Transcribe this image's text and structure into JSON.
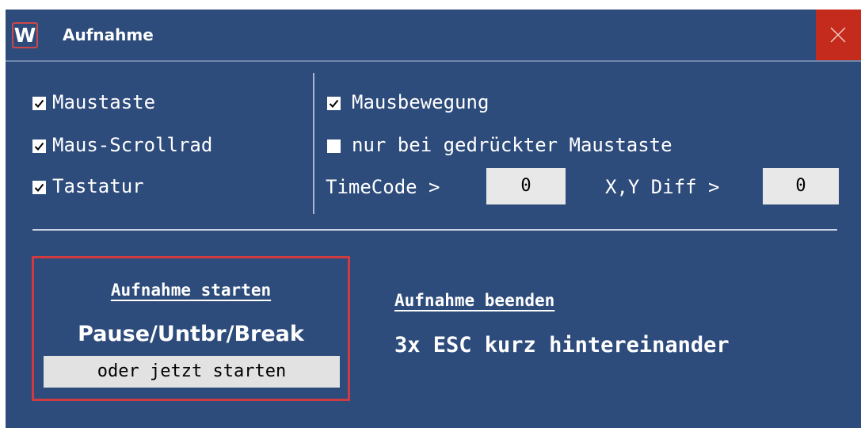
{
  "window": {
    "title": "Aufnahme",
    "icon_letter": "W",
    "icon": "w-app-icon",
    "close_icon": "close-icon",
    "colors": {
      "background": "#2d4b7b",
      "close": "#c42b1c",
      "accent_border": "#cf3b3e"
    }
  },
  "options": {
    "left": [
      {
        "label": "Maustaste",
        "checked": true
      },
      {
        "label": "Maus-Scrollrad",
        "checked": true
      },
      {
        "label": "Tastatur",
        "checked": true
      }
    ],
    "right": [
      {
        "label": "Mausbewegung",
        "checked": true
      },
      {
        "label": "nur bei gedrückter Maustaste",
        "checked": false
      }
    ],
    "timecode": {
      "label": "TimeCode >",
      "value": "0"
    },
    "xy_diff": {
      "label": "X,Y Diff >",
      "value": "0"
    }
  },
  "start": {
    "title": "Aufnahme starten",
    "key": "Pause/Untbr/Break",
    "button_label": "oder jetzt starten"
  },
  "end": {
    "title": "Aufnahme beenden",
    "key": "3x ESC kurz hintereinander"
  }
}
